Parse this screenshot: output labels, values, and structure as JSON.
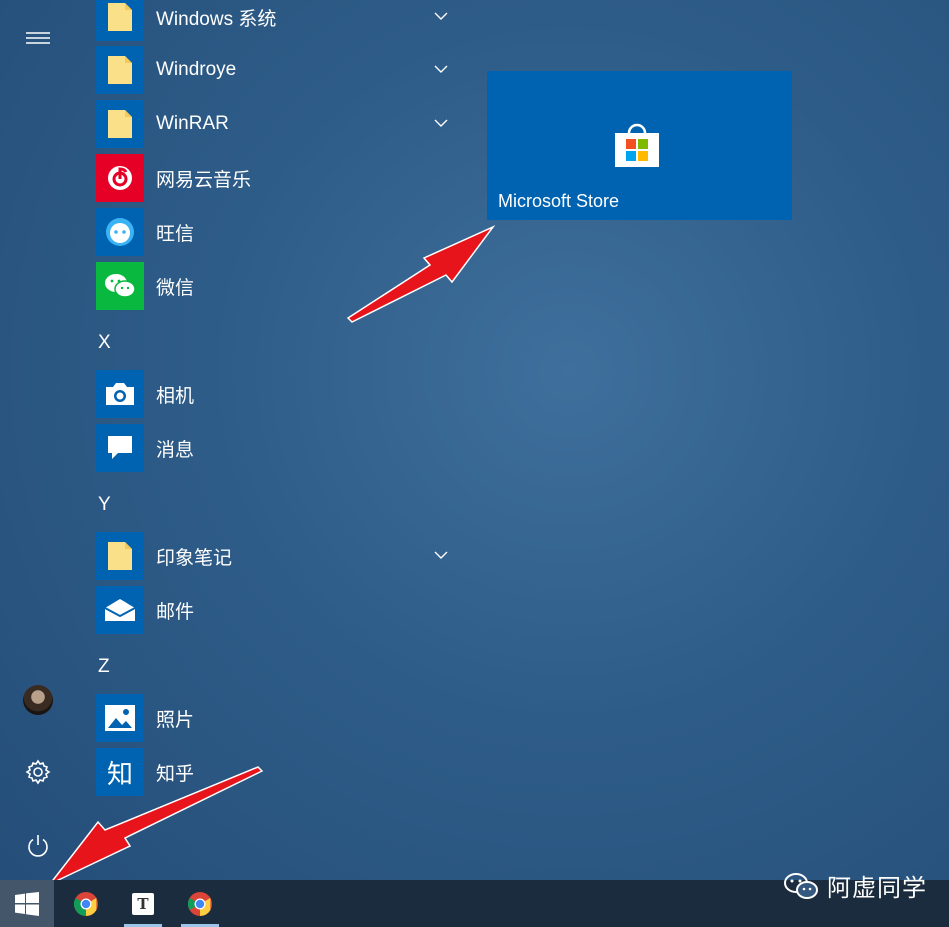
{
  "start_menu": {
    "apps": [
      {
        "label": "Windows 系统",
        "icon": "folder-icon",
        "expandable": true
      },
      {
        "label": "Windroye",
        "icon": "folder-icon",
        "expandable": true
      },
      {
        "label": "WinRAR",
        "icon": "folder-icon",
        "expandable": true
      },
      {
        "label": "网易云音乐",
        "icon": "netease-music-icon",
        "expandable": false
      },
      {
        "label": "旺信",
        "icon": "wangxin-icon",
        "expandable": false
      },
      {
        "label": "微信",
        "icon": "wechat-icon",
        "expandable": false
      },
      {
        "label": "相机",
        "icon": "camera-icon",
        "expandable": false
      },
      {
        "label": "消息",
        "icon": "messages-icon",
        "expandable": false
      },
      {
        "label": "印象笔记",
        "icon": "folder-icon",
        "expandable": true
      },
      {
        "label": "邮件",
        "icon": "mail-icon",
        "expandable": false
      },
      {
        "label": "照片",
        "icon": "photos-icon",
        "expandable": false
      },
      {
        "label": "知乎",
        "icon": "zhihu-icon",
        "expandable": false
      }
    ],
    "letters": [
      "X",
      "Y",
      "Z"
    ],
    "tile": {
      "label": "Microsoft Store",
      "icon": "store-bag-icon",
      "color": "#0063b1"
    },
    "rail": [
      "hamburger-menu-icon",
      "user-avatar",
      "gear-icon",
      "power-icon"
    ]
  },
  "zhihu_glyph": "知",
  "taskbar": {
    "apps": [
      "chrome-icon",
      "typora-icon",
      "chrome-icon"
    ],
    "typora_glyph": "T"
  },
  "watermark": {
    "text": "阿虚同学",
    "icon": "wechat-icon"
  },
  "colors": {
    "tile": "#0063b1",
    "taskbar": "#1b2c3e",
    "annotation_arrow": "#e8141b",
    "app_icon_bg": "#0063b1",
    "wechat": "#09b83e",
    "netease": "#e60026"
  }
}
